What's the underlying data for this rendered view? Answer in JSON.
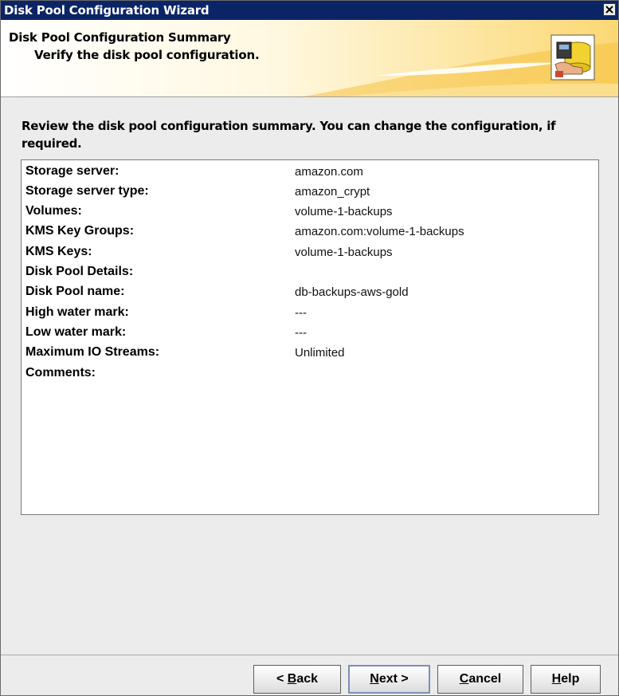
{
  "window": {
    "title": "Disk Pool Configuration Wizard"
  },
  "header": {
    "title": "Disk Pool Configuration Summary",
    "subtitle": "Verify the disk pool configuration."
  },
  "intro": "Review the disk pool configuration summary. You can change the configuration, if required.",
  "summary": [
    {
      "label": "Storage server:",
      "value": "amazon.com"
    },
    {
      "label": "Storage server type:",
      "value": "amazon_crypt"
    },
    {
      "label": "Volumes:",
      "value": "volume-1-backups"
    },
    {
      "label": "KMS Key Groups:",
      "value": "amazon.com:volume-1-backups"
    },
    {
      "label": "KMS Keys:",
      "value": "volume-1-backups"
    },
    {
      "label": "Disk Pool Details:",
      "value": ""
    },
    {
      "label": "Disk Pool name:",
      "value": "db-backups-aws-gold"
    },
    {
      "label": "High water mark:",
      "value": "---"
    },
    {
      "label": "Low water mark:",
      "value": "---"
    },
    {
      "label": "Maximum IO Streams:",
      "value": "Unlimited"
    },
    {
      "label": "Comments:",
      "value": ""
    }
  ],
  "buttons": {
    "back": {
      "prefix": "< ",
      "mnemonic": "B",
      "rest": "ack"
    },
    "next": {
      "prefix": "",
      "mnemonic": "N",
      "rest": "ext >"
    },
    "cancel": {
      "prefix": "",
      "mnemonic": "C",
      "rest": "ancel"
    },
    "help": {
      "prefix": "",
      "mnemonic": "H",
      "rest": "elp"
    }
  },
  "icons": {
    "close": "close-icon",
    "header": "disk-pool-icon"
  },
  "colors": {
    "titlebar": "#0a2466",
    "header_gradient_end": "#fcd873",
    "dialog_bg": "#ececec"
  }
}
